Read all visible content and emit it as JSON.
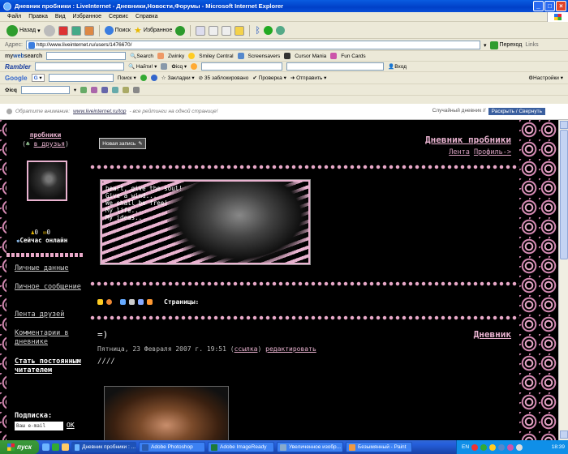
{
  "window": {
    "title": "Дневник пробники : LiveInternet - Дневники,Новости,Форумы - Microsoft Internet Explorer"
  },
  "menu": [
    "Файл",
    "Правка",
    "Вид",
    "Избранное",
    "Сервис",
    "Справка"
  ],
  "toolbar": {
    "back": "Назад",
    "search": "Поиск",
    "favorites": "Избранное"
  },
  "address": {
    "label": "Адрес:",
    "url": "http://www.liveinternet.ru/users/1476670/",
    "go": "Переход",
    "links": "Links"
  },
  "mywebsearch": {
    "brand_a": "my",
    "brand_b": "web",
    "brand_c": "search",
    "search": "Search",
    "items": [
      "Zwinky",
      "Smiley Central",
      "Screensavers",
      "Cursor Mania",
      "Fun Cards"
    ]
  },
  "rambler": {
    "brand": "Rambler",
    "find": "Найти!",
    "icq": "icq",
    "login": "Вход"
  },
  "google": {
    "brand": "Google",
    "g": "G",
    "search": "Поиск",
    "bookmarks": "Закладки",
    "blocked": "35 заблокировано",
    "check": "Проверка",
    "send": "Отправить",
    "settings": "Настройки"
  },
  "icqbar": {
    "label": "icq"
  },
  "notice": {
    "text_a": "Обратите внимание:",
    "link": "www.liveinternet.ru/top",
    "text_b": " - все рейтинги на одной странице!",
    "diary": "Случайный дневник //",
    "toggle": "Раскрыть / Свернуть"
  },
  "sidebar": {
    "username": "пробники",
    "friends": "в друзья",
    "count_a": "0",
    "count_b": "0",
    "online": "Сейчас онлайн",
    "links": [
      "Личные данные",
      "Личное сообщение",
      "Лента друзей",
      "Комментарии в дневнике"
    ],
    "subscribe_link": "Стать постоянным читателем",
    "subscribe_label": "Подписка:",
    "email_placeholder": "Ваш e-mail",
    "ok": "OK"
  },
  "main": {
    "new_post": "Новая запись",
    "diary_title": "Дневник пробники",
    "feed": "Лента",
    "profile": "Профиль->",
    "banner_text": "heart, give the soul!\nGive a wind...\nWe shall be free!\nMy life...\nMy ideas...",
    "pages_label": "Страницы:",
    "post_title": "=)",
    "post_category": "Дневник",
    "post_date": "Пятница, 23 Февраля 2007 г. 19:51",
    "post_link": "ссылка",
    "post_edit": "редактировать",
    "post_body": "////"
  },
  "taskbar": {
    "start": "пуск",
    "tasks": [
      "Дневник пробники : ...",
      "Adobe Photoshop",
      "Adobe ImageReady",
      "Увеличенное изобр...",
      "Безымянный - Paint"
    ],
    "lang": "EN",
    "time": "18:39"
  }
}
